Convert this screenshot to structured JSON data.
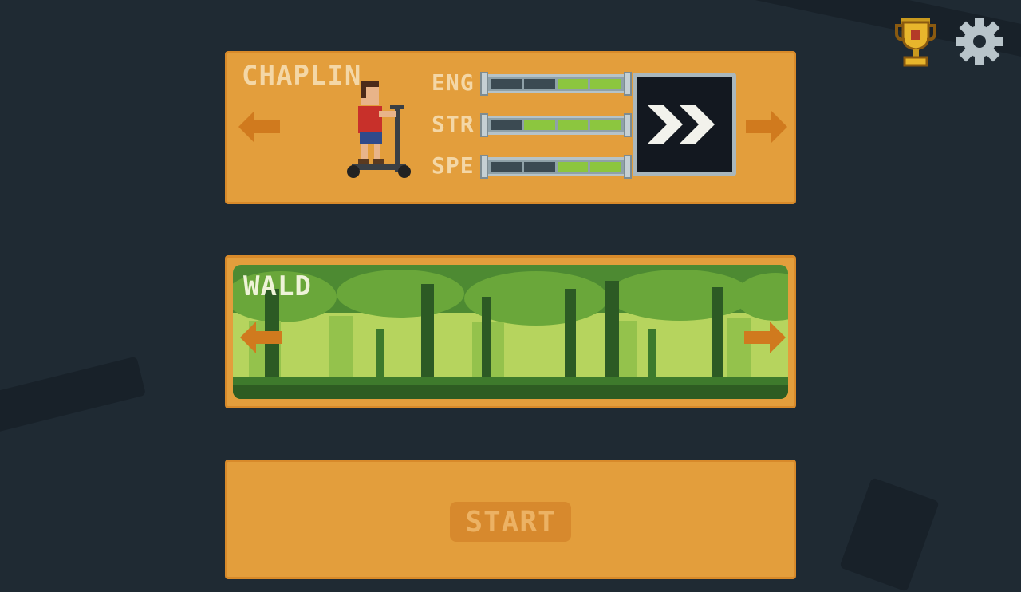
{
  "character": {
    "name": "CHAPLIN",
    "stats": [
      {
        "label": "ENG",
        "level": 0.5
      },
      {
        "label": "STR",
        "level": 0.75
      },
      {
        "label": "SPE",
        "level": 0.5
      }
    ],
    "boost_icon": "double-chevron-right-icon"
  },
  "level": {
    "name": "WALD"
  },
  "start": {
    "label": "START"
  },
  "icons": {
    "trophy": "trophy-icon",
    "settings": "gear-icon"
  },
  "colors": {
    "background": "#1f2a33",
    "panel": "#e39e3c",
    "arrow": "#d07a1e",
    "bar_fill": "#8cc63f",
    "forest": "#7fae3a"
  }
}
